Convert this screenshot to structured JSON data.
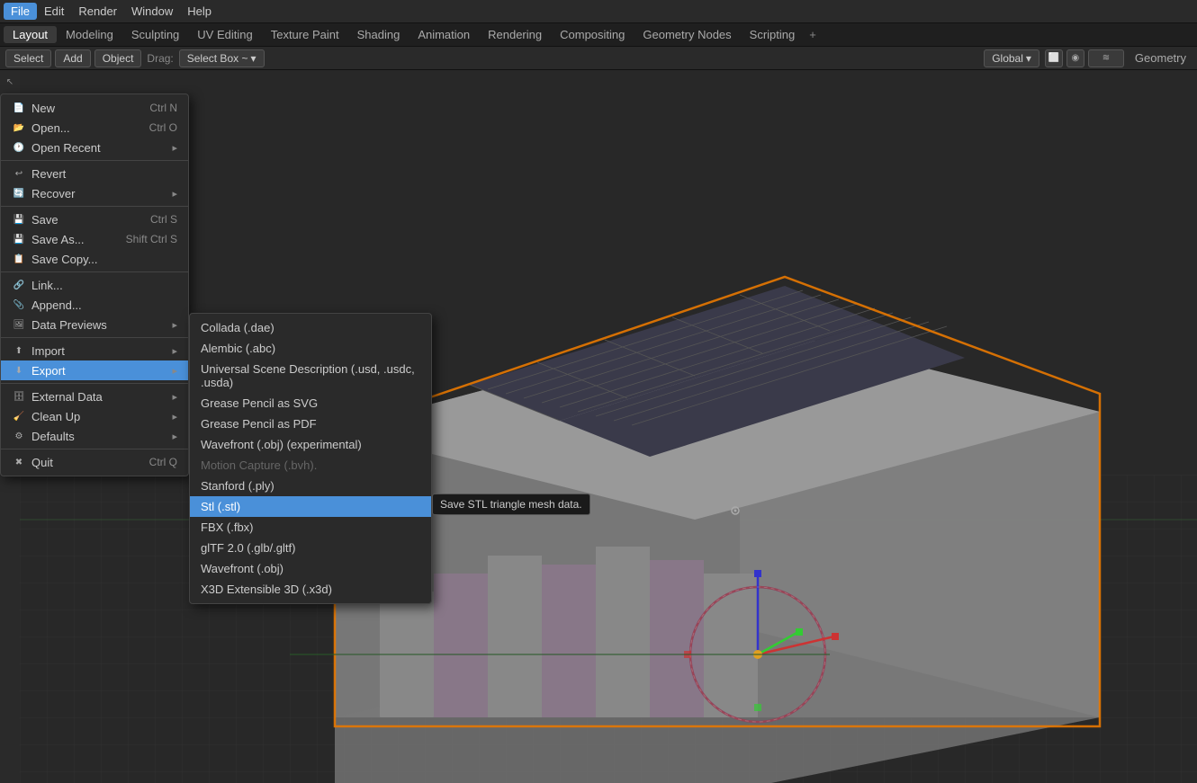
{
  "topMenuBar": {
    "items": [
      {
        "label": "File",
        "active": true
      },
      {
        "label": "Edit"
      },
      {
        "label": "Render"
      },
      {
        "label": "Window"
      },
      {
        "label": "Help"
      }
    ]
  },
  "workspaceTabs": {
    "tabs": [
      {
        "label": "Layout",
        "active": true
      },
      {
        "label": "Modeling"
      },
      {
        "label": "Sculpting"
      },
      {
        "label": "UV Editing"
      },
      {
        "label": "Texture Paint"
      },
      {
        "label": "Shading"
      },
      {
        "label": "Animation"
      },
      {
        "label": "Rendering"
      },
      {
        "label": "Compositing"
      },
      {
        "label": "Geometry Nodes"
      },
      {
        "label": "Scripting"
      }
    ],
    "plusLabel": "+"
  },
  "viewportToolbar": {
    "buttons": [
      {
        "label": "Select"
      },
      {
        "label": "Add"
      },
      {
        "label": "Object"
      }
    ],
    "drag_label": "Drag:",
    "select_box": "Select Box ~",
    "global_btn": "Global",
    "geometry_label": "Geometry"
  },
  "fileMenu": {
    "new_label": "New",
    "new_shortcut": "Ctrl N",
    "open_label": "Open...",
    "open_shortcut": "Ctrl O",
    "open_recent_label": "Open Recent",
    "revert_label": "Revert",
    "recover_label": "Recover",
    "save_label": "Save",
    "save_shortcut": "Ctrl S",
    "save_as_label": "Save As...",
    "save_as_shortcut": "Shift Ctrl S",
    "save_copy_label": "Save Copy...",
    "link_label": "Link...",
    "append_label": "Append...",
    "data_previews_label": "Data Previews",
    "import_label": "Import",
    "export_label": "Export",
    "external_data_label": "External Data",
    "clean_up_label": "Clean Up",
    "defaults_label": "Defaults",
    "quit_label": "Quit",
    "quit_shortcut": "Ctrl Q"
  },
  "exportSubmenu": {
    "items": [
      {
        "label": "Collada (.dae)",
        "disabled": false
      },
      {
        "label": "Alembic (.abc)",
        "disabled": false
      },
      {
        "label": "Universal Scene Description (.usd, .usdc, .usda)",
        "disabled": false
      },
      {
        "label": "Grease Pencil as SVG",
        "disabled": false
      },
      {
        "label": "Grease Pencil as PDF",
        "disabled": false
      },
      {
        "label": "Wavefront (.obj) (experimental)",
        "disabled": false
      },
      {
        "label": "Motion Capture (.bvh).",
        "disabled": true
      },
      {
        "label": "Stanford (.ply)",
        "disabled": false
      },
      {
        "label": "Stl (.stl)",
        "active": true
      },
      {
        "label": "FBX (.fbx)",
        "disabled": false
      },
      {
        "label": "glTF 2.0 (.glb/.gltf)",
        "disabled": false
      },
      {
        "label": "Wavefront (.obj)",
        "disabled": false
      },
      {
        "label": "X3D Extensible 3D (.x3d)",
        "disabled": false
      }
    ],
    "tooltip": "Save STL triangle mesh data."
  }
}
